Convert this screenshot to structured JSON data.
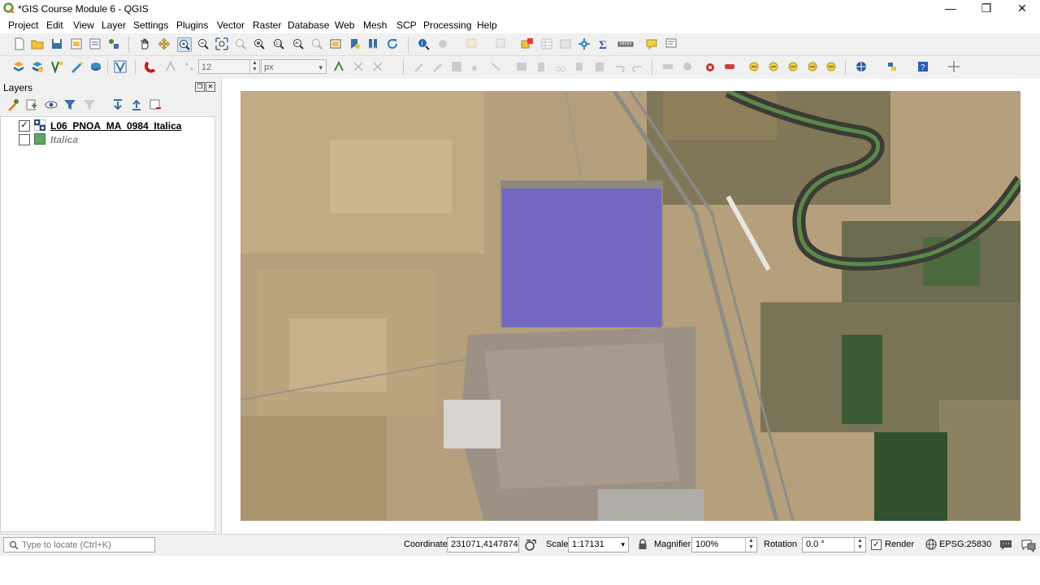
{
  "window": {
    "title": "*GIS Course Module 6 - QGIS",
    "controls": {
      "minimize": "—",
      "maximize": "❐",
      "close": "✕"
    }
  },
  "menubar": {
    "items": [
      "Project",
      "Edit",
      "View",
      "Layer",
      "Settings",
      "Plugins",
      "Vector",
      "Raster",
      "Database",
      "Web",
      "Mesh",
      "SCP",
      "Processing",
      "Help"
    ]
  },
  "toolbar": {
    "snap_tolerance_value": "12",
    "snap_units": "px"
  },
  "layers_panel": {
    "title": "Layers",
    "layers": [
      {
        "name": "L06_PNOA_MA_0984_Italica",
        "checked": true,
        "icon": "raster-layer-icon"
      },
      {
        "name": "Italica",
        "checked": false,
        "icon": "polygon-layer-icon",
        "color": "#5fa660"
      }
    ]
  },
  "map": {
    "selection_color": "#6e5fd7"
  },
  "statusbar": {
    "locate_placeholder": "Type to locate (Ctrl+K)",
    "coordinate_label": "Coordinate",
    "coordinate_value": "231071,4147874",
    "scale_label": "Scale",
    "scale_value": "1:17131",
    "magnifier_label": "Magnifier",
    "magnifier_value": "100%",
    "rotation_label": "Rotation",
    "rotation_value": "0.0 °",
    "render_label": "Render",
    "render_checked": true,
    "crs": "EPSG:25830"
  }
}
